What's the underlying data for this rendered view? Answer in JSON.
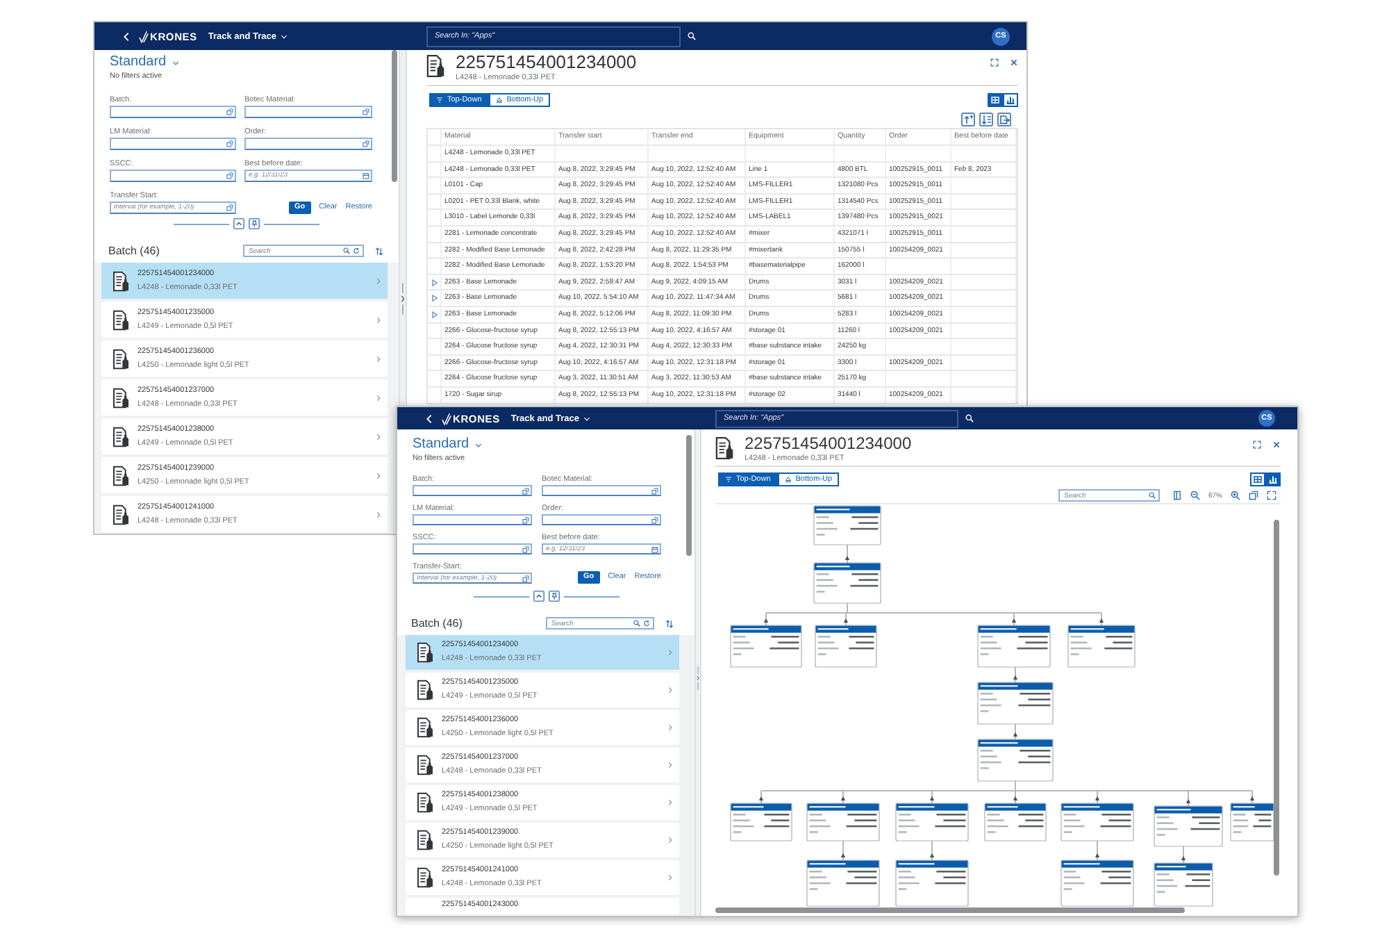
{
  "windows": [
    {
      "shell": {
        "logo": "KRONES",
        "app_title": "Track and Trace",
        "search_placeholder": "Search In: \"Apps\"",
        "avatar": "CS"
      },
      "filter_bar": {
        "variant": "Standard",
        "status": "No filters active",
        "fields": [
          {
            "label": "Batch:",
            "kind": "value_help"
          },
          {
            "label": "Botec Material:",
            "kind": "value_help"
          },
          {
            "label": "LM Material:",
            "kind": "value_help"
          },
          {
            "label": "Order:",
            "kind": "value_help"
          },
          {
            "label": "SSCC:",
            "kind": "value_help"
          },
          {
            "label": "Best before date:",
            "kind": "date",
            "placeholder": "e.g. 12/31/23"
          },
          {
            "label": "Transfer Start:",
            "kind": "value_help",
            "placeholder": "Interval (for example, 1-20)"
          }
        ],
        "buttons": [
          {
            "label": "Go",
            "kind": "primary"
          },
          {
            "label": "Clear",
            "kind": "plain"
          },
          {
            "label": "Restore",
            "kind": "plain"
          }
        ]
      },
      "batch_list": {
        "title": "Batch (46)",
        "search_placeholder": "Search",
        "items": [
          {
            "batch": "225751454001234000",
            "material": "L4248 - Lemonade 0,33l PET",
            "selected": true
          },
          {
            "batch": "225751454001235000",
            "material": "L4249 - Lemonade 0,5l PET",
            "selected": false
          },
          {
            "batch": "225751454001236000",
            "material": "L4250 - Lemonade light 0,5l PET",
            "selected": false
          },
          {
            "batch": "225751454001237000",
            "material": "L4248 - Lemonade 0,33l PET",
            "selected": false
          },
          {
            "batch": "225751454001238000",
            "material": "L4249 - Lemonade 0,5l PET",
            "selected": false
          },
          {
            "batch": "225751454001239000",
            "material": "L4250 - Lemonade light 0,5l PET",
            "selected": false
          },
          {
            "batch": "225751454001241000",
            "material": "L4248 - Lemonade 0,33l PET",
            "selected": false
          }
        ]
      },
      "detail": {
        "title": "225751454001234000",
        "subtitle": "L4248 - Lemonade 0,33l PET",
        "directions": [
          {
            "label": "Top-Down",
            "kind": "top_down",
            "selected": true
          },
          {
            "label": "Bottom-Up",
            "kind": "bottom_up",
            "selected": false
          }
        ],
        "views": [
          {
            "kind": "table",
            "selected": true
          },
          {
            "kind": "graph",
            "selected": false
          }
        ],
        "table": {
          "columns": [
            "Material",
            "Transfer start",
            "Transfer end",
            "Equipment",
            "Quantity",
            "Order",
            "Best before date"
          ],
          "rows": [
            {
              "expandable": false,
              "material": "L4248 - Lemonade 0,33l PET"
            },
            {
              "expandable": false,
              "material": "L4248 - Lemonade 0,33l PET",
              "transfer_start": "Aug 8, 2022, 3:29:45 PM",
              "transfer_end": "Aug 10, 2022, 12:52:40 AM",
              "equipment": "Line 1",
              "quantity": "4800 BTL",
              "order": "100252915_0011",
              "best_before_date": "Feb 8, 2023"
            },
            {
              "expandable": false,
              "material": "L0101 - Cap",
              "transfer_start": "Aug 8, 2022, 3:29:45 PM",
              "transfer_end": "Aug 10, 2022, 12:52:40 AM",
              "equipment": "LMS-FILLER1",
              "quantity": "1321080 Pcs",
              "order": "100252915_0011"
            },
            {
              "expandable": false,
              "material": "L0201 - PET 0,33l Blank, white",
              "transfer_start": "Aug 8, 2022, 3:29:45 PM",
              "transfer_end": "Aug 10, 2022, 12:52:40 AM",
              "equipment": "LMS-FILLER1",
              "quantity": "1314540 Pcs",
              "order": "100252915_0011"
            },
            {
              "expandable": false,
              "material": "L3010 - Label Lemonde 0,33l",
              "transfer_start": "Aug 8, 2022, 3:29:45 PM",
              "transfer_end": "Aug 10, 2022, 12:52:40 AM",
              "equipment": "LMS-LABEL1",
              "quantity": "1397480 Pcs",
              "order": "100252915_0021"
            },
            {
              "expandable": false,
              "material": "2281 - Lemonade concentrate",
              "transfer_start": "Aug 8, 2022, 3:29:45 PM",
              "transfer_end": "Aug 10, 2022, 12:52:40 AM",
              "equipment": "#mixer",
              "quantity": "4321071 l",
              "order": "100252915_0011"
            },
            {
              "expandable": false,
              "material": "2282 - Modified Base Lemonade",
              "transfer_start": "Aug 8, 2022, 2:42:28 PM",
              "transfer_end": "Aug 8, 2022, 11:29:35 PM",
              "equipment": "#mixertank",
              "quantity": "150755 l",
              "order": "100254209_0021"
            },
            {
              "expandable": false,
              "material": "2282 - Modified Base Lemonade",
              "transfer_start": "Aug 8, 2022, 1:53:20 PM",
              "transfer_end": "Aug 8, 2022, 1:54:53 PM",
              "equipment": "#basematerialpipe",
              "quantity": "162000 l"
            },
            {
              "expandable": true,
              "material": "2263 - Base Lemonade",
              "transfer_start": "Aug 9, 2022, 2:58:47 AM",
              "transfer_end": "Aug 9, 2022, 4:09:15 AM",
              "equipment": "Drums",
              "quantity": "3031 l",
              "order": "100254209_0021"
            },
            {
              "expandable": true,
              "material": "2263 - Base Lemonade",
              "transfer_start": "Aug 10, 2022, 5:54:10 AM",
              "transfer_end": "Aug 10, 2022, 11:47:34 AM",
              "equipment": "Drums",
              "quantity": "5681 l",
              "order": "100254209_0021"
            },
            {
              "expandable": true,
              "material": "2263 - Base Lemonade",
              "transfer_start": "Aug 8, 2022, 5:12:06 PM",
              "transfer_end": "Aug 8, 2022, 11:09:30 PM",
              "equipment": "Drums",
              "quantity": "5283 l",
              "order": "100254209_0021"
            },
            {
              "expandable": false,
              "material": "2266 - Glucose-fructose syrup",
              "transfer_start": "Aug 8, 2022, 12:55:13 PM",
              "transfer_end": "Aug 10, 2022, 4:16:57 AM",
              "equipment": "#storage 01",
              "quantity": "11260 l",
              "order": "100254209_0021"
            },
            {
              "expandable": false,
              "material": "2264 - Glucose fructose syrup",
              "transfer_start": "Aug 4, 2022, 12:30:31 PM",
              "transfer_end": "Aug 4, 2022, 12:30:33 PM",
              "equipment": "#base substance intake",
              "quantity": "24250 kg"
            },
            {
              "expandable": false,
              "material": "2266 - Glucose-fructose syrup",
              "transfer_start": "Aug 10, 2022, 4:16:57 AM",
              "transfer_end": "Aug 10, 2022, 12:31:18 PM",
              "equipment": "#storage 01",
              "quantity": "3300 l",
              "order": "100254209_0021"
            },
            {
              "expandable": false,
              "material": "2264 - Glucose fructose syrup",
              "transfer_start": "Aug 3, 2022, 11:30:51 AM",
              "transfer_end": "Aug 3, 2022, 11:30:53 AM",
              "equipment": "#base substance intake",
              "quantity": "25170 kg"
            },
            {
              "expandable": false,
              "material": "1720 - Sugar sirup",
              "transfer_start": "Aug 8, 2022, 12:55:13 PM",
              "transfer_end": "Aug 10, 2022, 12:31:18 PM",
              "equipment": "#storage 02",
              "quantity": "31440 l",
              "order": "100254209_0021"
            }
          ]
        }
      }
    },
    {
      "shell": {
        "logo": "KRONES",
        "app_title": "Track and Trace",
        "search_placeholder": "Search In: \"Apps\"",
        "avatar": "CS"
      },
      "filter_bar": {
        "variant": "Standard",
        "status": "No filters active",
        "fields": [
          {
            "label": "Batch:",
            "kind": "value_help"
          },
          {
            "label": "Botec Material:",
            "kind": "value_help"
          },
          {
            "label": "LM Material:",
            "kind": "value_help"
          },
          {
            "label": "Order:",
            "kind": "value_help"
          },
          {
            "label": "SSCC:",
            "kind": "value_help"
          },
          {
            "label": "Best before date:",
            "kind": "date",
            "placeholder": "e.g. 12/31/23"
          },
          {
            "label": "Transfer-Start:",
            "kind": "value_help",
            "placeholder": "Interval (for example, 1-20)"
          }
        ],
        "buttons": [
          {
            "label": "Go",
            "kind": "primary"
          },
          {
            "label": "Clear",
            "kind": "plain"
          },
          {
            "label": "Restore",
            "kind": "plain"
          }
        ]
      },
      "batch_list": {
        "title": "Batch (46)",
        "search_placeholder": "Search",
        "items": [
          {
            "batch": "225751454001234000",
            "material": "L4248 - Lemonade 0,33l PET",
            "selected": true
          },
          {
            "batch": "225751454001235000",
            "material": "L4249 - Lemonade 0,5l PET",
            "selected": false
          },
          {
            "batch": "225751454001236000",
            "material": "L4250 - Lemonade light 0,5l PET",
            "selected": false
          },
          {
            "batch": "225751454001237000",
            "material": "L4248 - Lemonade 0,33l PET",
            "selected": false
          },
          {
            "batch": "225751454001238000",
            "material": "L4249 - Lemonade 0,5l PET",
            "selected": false
          },
          {
            "batch": "225751454001239000",
            "material": "L4250 - Lemonade light 0,5l PET",
            "selected": false
          },
          {
            "batch": "225751454001241000",
            "material": "L4248 - Lemonade 0,33l PET",
            "selected": false
          },
          {
            "batch": "225751454001243000",
            "selected": false
          }
        ]
      },
      "detail": {
        "title": "225751454001234000",
        "subtitle": "L4248 - Lemonade 0,33l PET",
        "directions": [
          {
            "label": "Top-Down",
            "kind": "top_down",
            "selected": true
          },
          {
            "label": "Bottom-Up",
            "kind": "bottom_up",
            "selected": false
          }
        ],
        "views": [
          {
            "kind": "table",
            "selected": false
          },
          {
            "kind": "graph",
            "selected": true
          }
        ],
        "diagram": {
          "search_placeholder": "Search",
          "zoom": "67%"
        }
      }
    }
  ]
}
